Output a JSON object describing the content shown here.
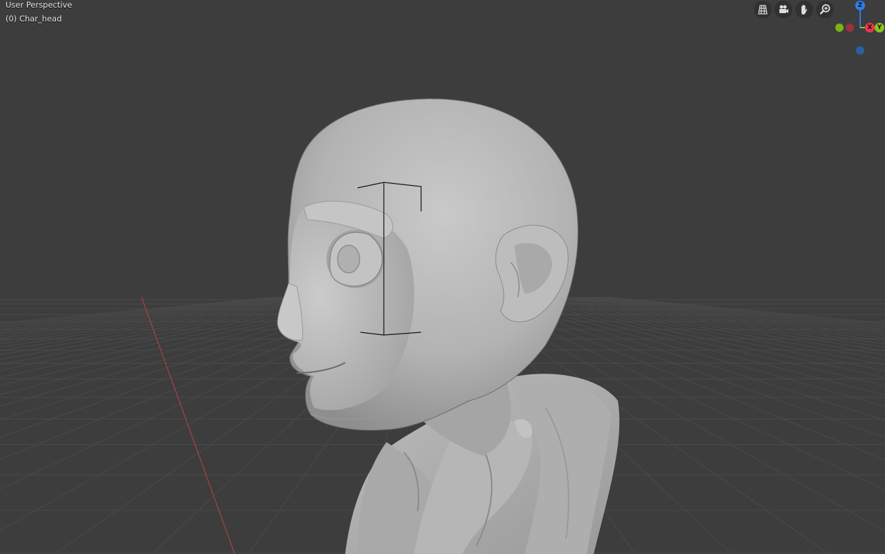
{
  "viewport": {
    "view_name": "User Perspective",
    "object_name": "(0) Char_head",
    "background": "#3d3d3d",
    "grid_color": "#4a4a4a",
    "x_axis_color": "#b04040"
  },
  "navigation_tools": [
    {
      "name": "toggle-ortho-grid-icon",
      "tooltip": "Toggle perspective/orthographic"
    },
    {
      "name": "camera-icon",
      "tooltip": "Camera view"
    },
    {
      "name": "hand-pan-icon",
      "tooltip": "Move view"
    },
    {
      "name": "zoom-icon",
      "tooltip": "Zoom view"
    }
  ],
  "axis_gizmo": {
    "z_label": "Z",
    "x_label": "X",
    "y_label": "Y",
    "z_color": "#2e7fe8",
    "x_color": "#e8384f",
    "y_color": "#8cc21f",
    "neg_z_color": "#2e5fa6",
    "neg_x_color": "#9a3040",
    "neg_y_color": "#6aa21a"
  },
  "model": {
    "object": "Char_head",
    "skin_color": "#b8b8b8"
  }
}
